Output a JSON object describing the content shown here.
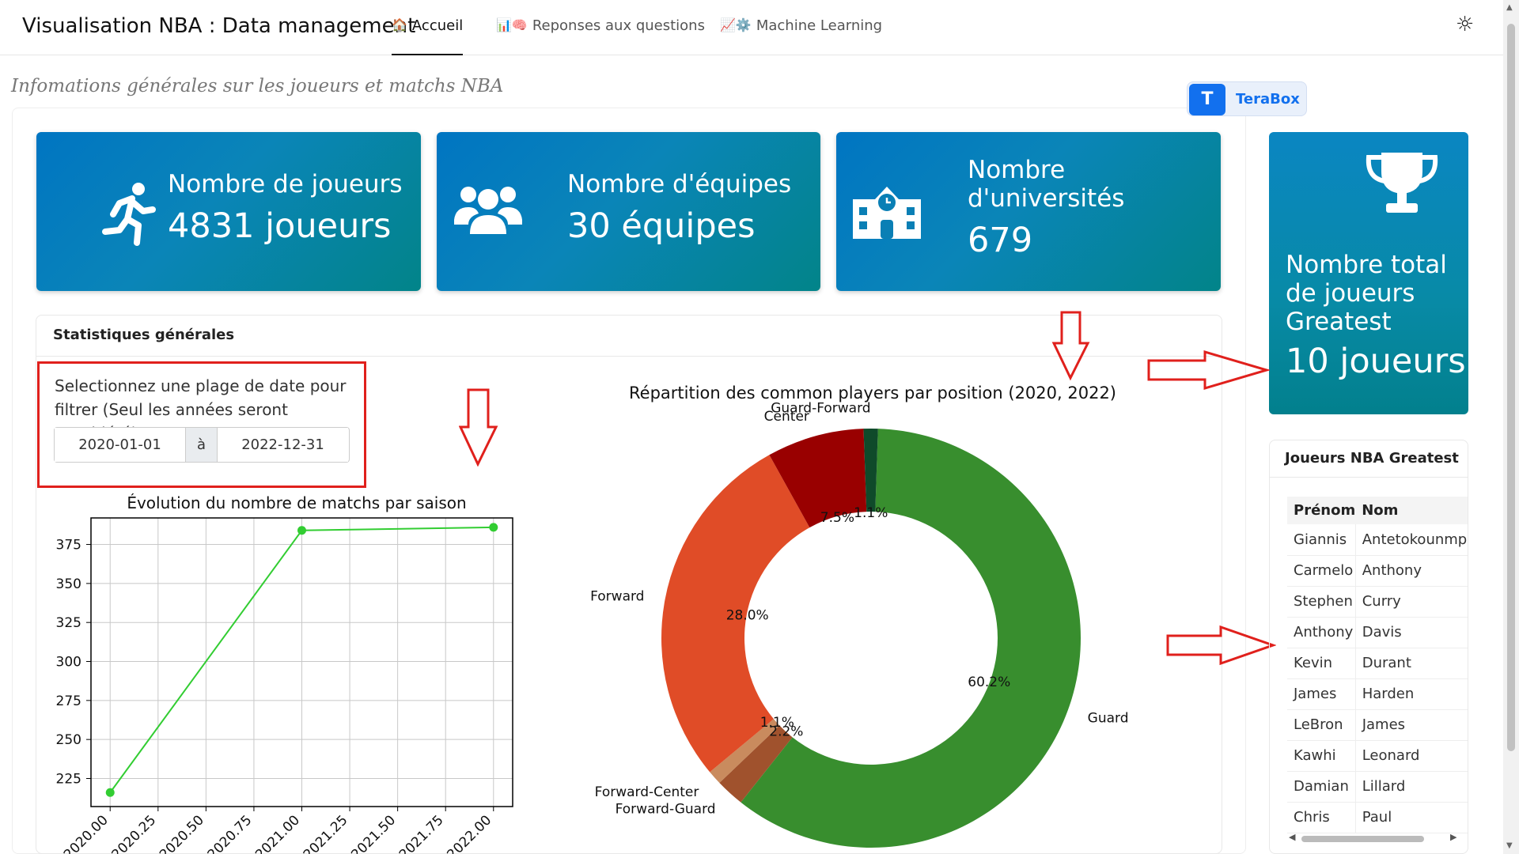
{
  "header": {
    "app_title": "Visualisation NBA : Data management",
    "tabs": [
      {
        "label": "Accueil",
        "icon": "house-emoji",
        "active": true
      },
      {
        "label": "Reponses aux questions",
        "icon": "chart-brain-emoji",
        "active": false
      },
      {
        "label": "Machine Learning",
        "icon": "chart-gear-emoji",
        "active": false
      }
    ],
    "theme_icon": "sun-icon"
  },
  "page_subtitle": "Infomations générales sur les joueurs et matchs NBA",
  "terabox": {
    "label": "TeraBox",
    "color": "#1270ee"
  },
  "kpis": [
    {
      "icon": "running-person-icon",
      "label": "Nombre de joueurs",
      "value": "4831 joueurs"
    },
    {
      "icon": "people-group-icon",
      "label": "Nombre d'équipes",
      "value": "30 équipes"
    },
    {
      "icon": "school-building-icon",
      "label_line1": "Nombre",
      "label_line2": "d'universités",
      "value": "679"
    }
  ],
  "side_kpi": {
    "icon": "trophy-icon",
    "label": "Nombre total de joueurs Greatest",
    "value": "10 joueurs"
  },
  "stats": {
    "title": "Statistiques générales",
    "filter_text": "Selectionnez une plage de date pour filtrer (Seul les années seront considéré)",
    "date_start": "2020-01-01",
    "date_sep": "à",
    "date_end": "2022-12-31"
  },
  "greatest": {
    "title": "Joueurs NBA Greatest",
    "columns": [
      "Prénom",
      "Nom"
    ],
    "rows": [
      [
        "Giannis",
        "Antetokounmpo"
      ],
      [
        "Carmelo",
        "Anthony"
      ],
      [
        "Stephen",
        "Curry"
      ],
      [
        "Anthony",
        "Davis"
      ],
      [
        "Kevin",
        "Durant"
      ],
      [
        "James",
        "Harden"
      ],
      [
        "LeBron",
        "James"
      ],
      [
        "Kawhi",
        "Leonard"
      ],
      [
        "Damian",
        "Lillard"
      ],
      [
        "Chris",
        "Paul"
      ]
    ]
  },
  "colors": {
    "accent": "#0075c2",
    "annotation": "#e0201c",
    "line": "#32cd32"
  },
  "chart_data": [
    {
      "type": "line",
      "title": "Évolution du nombre de matchs par saison",
      "x": [
        2020,
        2021,
        2022
      ],
      "series": [
        {
          "values": [
            216,
            384,
            386
          ]
        }
      ],
      "xticks": [
        "2020.00",
        "2020.25",
        "2020.50",
        "2020.75",
        "2021.00",
        "2021.25",
        "2021.50",
        "2021.75",
        "2022.00"
      ],
      "yticks": [
        "225",
        "250",
        "275",
        "300",
        "325",
        "350",
        "375"
      ],
      "xlim": [
        2019.9,
        2022.1
      ],
      "ylim": [
        207,
        392
      ],
      "grid": true
    },
    {
      "type": "pie",
      "donut": true,
      "title": "Répartition des common players par position (2020, 2022)",
      "slices": [
        {
          "label": "Guard",
          "pct": "60.2%",
          "value": 60.2,
          "color": "#388e2e"
        },
        {
          "label": "Forward-Guard",
          "pct": "2.2%",
          "value": 2.2,
          "color": "#a0522d"
        },
        {
          "label": "Forward-Center",
          "pct": "1.1%",
          "value": 1.1,
          "color": "#c98b5e"
        },
        {
          "label": "Forward",
          "pct": "28.0%",
          "value": 28.0,
          "color": "#e04c27"
        },
        {
          "label": "Center",
          "pct": "7.5%",
          "value": 7.5,
          "color": "#990000"
        },
        {
          "label": "Guard-Forward",
          "pct": "1.1%",
          "value": 1.1,
          "color": "#0f4a2a"
        }
      ]
    }
  ]
}
